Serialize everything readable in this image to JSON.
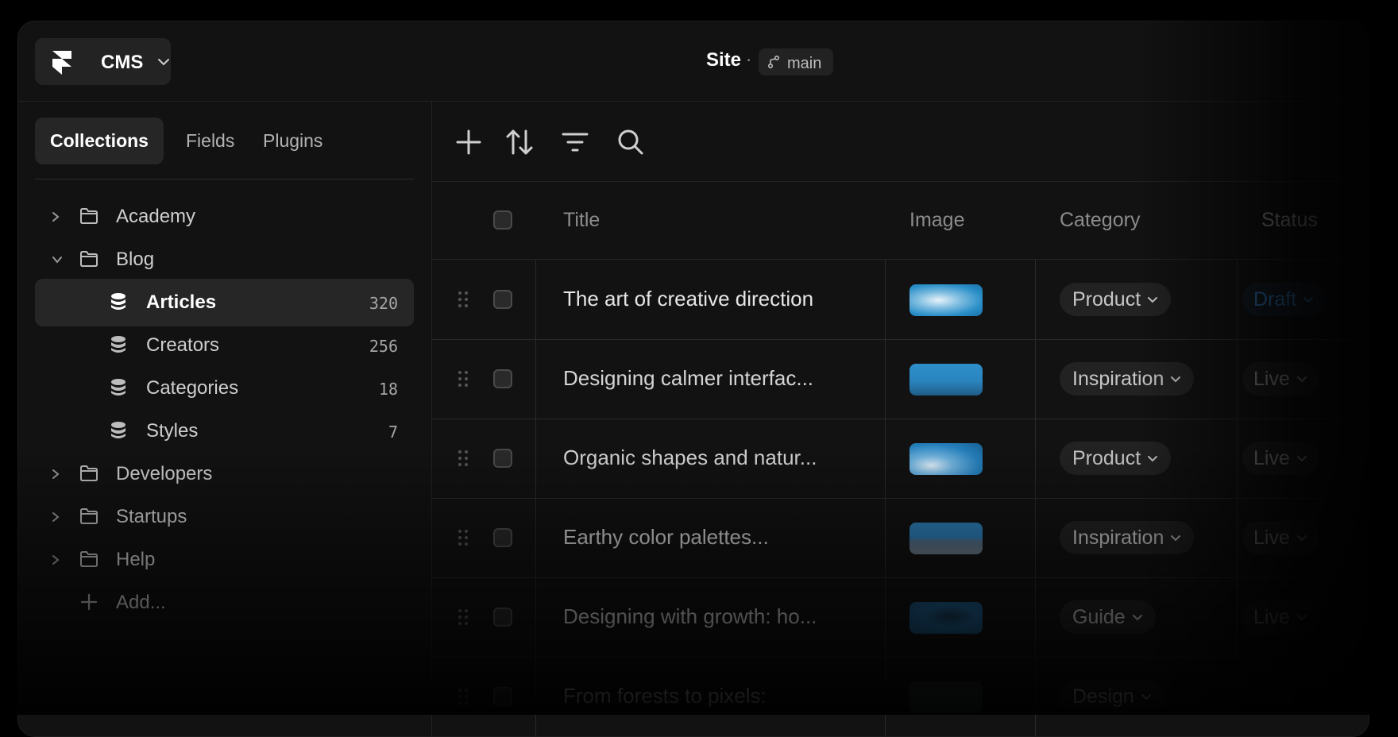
{
  "header": {
    "app_label": "CMS",
    "site_title": "Site",
    "separator": "·",
    "branch": "main"
  },
  "sidebar": {
    "tabs": [
      {
        "label": "Collections",
        "active": true
      },
      {
        "label": "Fields",
        "active": false
      },
      {
        "label": "Plugins",
        "active": false
      }
    ],
    "tree": [
      {
        "label": "Academy",
        "type": "folder",
        "expanded": false
      },
      {
        "label": "Blog",
        "type": "folder",
        "expanded": true
      },
      {
        "label": "Articles",
        "type": "collection",
        "count": "320",
        "active": true
      },
      {
        "label": "Creators",
        "type": "collection",
        "count": "256"
      },
      {
        "label": "Categories",
        "type": "collection",
        "count": "18"
      },
      {
        "label": "Styles",
        "type": "collection",
        "count": "7"
      },
      {
        "label": "Developers",
        "type": "folder",
        "expanded": false
      },
      {
        "label": "Startups",
        "type": "folder",
        "expanded": false
      },
      {
        "label": "Help",
        "type": "folder",
        "expanded": false
      },
      {
        "label": "Add...",
        "type": "add"
      }
    ]
  },
  "toolbar": {
    "icons": [
      "plus-icon",
      "sort-icon",
      "filter-icon",
      "search-icon"
    ]
  },
  "table": {
    "columns": [
      "Title",
      "Image",
      "Category",
      "Status"
    ],
    "rows": [
      {
        "title": "The art of creative direction",
        "category": "Product",
        "status": "Draft"
      },
      {
        "title": "Designing calmer interfac...",
        "category": "Inspiration",
        "status": "Live"
      },
      {
        "title": "Organic shapes and natur...",
        "category": "Product",
        "status": "Live"
      },
      {
        "title": "Earthy color palettes...",
        "category": "Inspiration",
        "status": "Live"
      },
      {
        "title": "Designing with growth: ho...",
        "category": "Guide",
        "status": "Live"
      },
      {
        "title": "From forests to pixels:",
        "category": "Design",
        "status": ""
      }
    ]
  },
  "colors": {
    "background": "#121212",
    "pill_bg": "#222222",
    "draft_status": "#2f6fa8",
    "text_primary": "#ffffff",
    "text_muted": "#8c8c8c"
  }
}
